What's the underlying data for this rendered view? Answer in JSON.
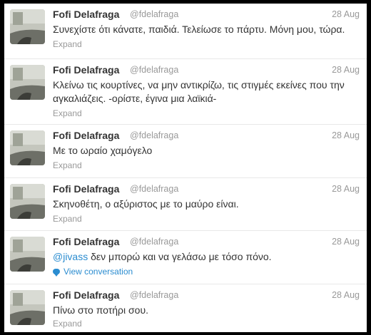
{
  "tweets": [
    {
      "name": "Fofi Delafraga",
      "handle": "@fdelafraga",
      "time": "28 Aug",
      "text": "Συνεχίστε ότι κάνατε, παιδιά. Τελείωσε το πάρτυ. Μόνη μου, τώρα.",
      "action": "Expand"
    },
    {
      "name": "Fofi Delafraga",
      "handle": "@fdelafraga",
      "time": "28 Aug",
      "text_line1": "Κλείνω τις κουρτίνες, να μην αντικρίζω, τις στιγμές εκείνες που την",
      "text_line2": "αγκαλιάζεις. -ορίστε, έγινα μια λαϊκιά-",
      "action": "Expand"
    },
    {
      "name": "Fofi Delafraga",
      "handle": "@fdelafraga",
      "time": "28 Aug",
      "text": "Με το ωραίο χαμόγελο",
      "action": "Expand"
    },
    {
      "name": "Fofi Delafraga",
      "handle": "@fdelafraga",
      "time": "28 Aug",
      "text": "Σκηνοθέτη, ο αξύριστος με το μαύρο είναι.",
      "action": "Expand"
    },
    {
      "name": "Fofi Delafraga",
      "handle": "@fdelafraga",
      "time": "28 Aug",
      "mention": "@jivass",
      "text": " δεν μπορώ και να γελάσω με τόσο πόνο.",
      "action": "View conversation",
      "action_icon": "conversation-bubble-icon"
    },
    {
      "name": "Fofi Delafraga",
      "handle": "@fdelafraga",
      "time": "28 Aug",
      "text": "Πίνω στο ποτήρι σου.",
      "action": "Expand"
    }
  ],
  "colors": {
    "link": "#2a8cd0",
    "meta": "#999999",
    "text": "#333333",
    "frame": "#000000"
  }
}
